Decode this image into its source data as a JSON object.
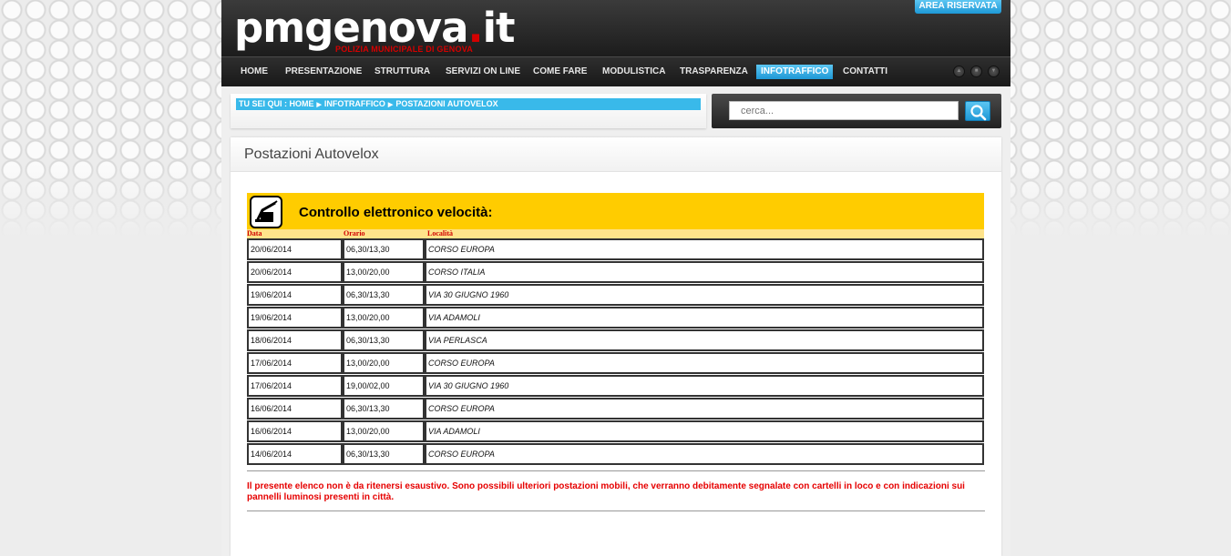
{
  "header": {
    "logo_main": "pmgenova",
    "logo_dot": ".",
    "logo_tld": "it",
    "logo_sub": "POLIZIA MUNICIPALE DI GENOVA",
    "area_riservata": "AREA RISERVATA"
  },
  "nav": {
    "items": [
      {
        "label": "HOME"
      },
      {
        "label": "PRESENTAZIONE"
      },
      {
        "label": "STRUTTURA"
      },
      {
        "label": "SERVIZI ON LINE"
      },
      {
        "label": "COME FARE"
      },
      {
        "label": "MODULISTICA"
      },
      {
        "label": "TRASPARENZA"
      },
      {
        "label": "INFOTRAFFICO",
        "active": true
      },
      {
        "label": "CONTATTI"
      }
    ]
  },
  "breadcrumb": {
    "prefix": "TU SEI QUI :",
    "items": [
      "HOME",
      "INFOTRAFFICO",
      "POSTAZIONI AUTOVELOX"
    ]
  },
  "search": {
    "placeholder": "cerca..."
  },
  "content": {
    "title": "Postazioni Autovelox",
    "banner_title": "Controllo elettronico velocità:",
    "columns": [
      "Data",
      "Orario",
      "Località"
    ],
    "rows": [
      [
        "20/06/2014",
        "06,30/13,30",
        "CORSO EUROPA"
      ],
      [
        "20/06/2014",
        "13,00/20,00",
        "CORSO ITALIA"
      ],
      [
        "19/06/2014",
        "06,30/13,30",
        "VIA 30 GIUGNO 1960"
      ],
      [
        "19/06/2014",
        "13,00/20,00",
        "VIA ADAMOLI"
      ],
      [
        "18/06/2014",
        "06,30/13,30",
        "VIA PERLASCA"
      ],
      [
        "17/06/2014",
        "13,00/20,00",
        "CORSO EUROPA"
      ],
      [
        "17/06/2014",
        "19,00/02,00",
        "VIA 30 GIUGNO 1960"
      ],
      [
        "16/06/2014",
        "06,30/13,30",
        "CORSO EUROPA"
      ],
      [
        "16/06/2014",
        "13,00/20,00",
        "VIA ADAMOLI"
      ],
      [
        "14/06/2014",
        "06,30/13,30",
        "CORSO EUROPA"
      ]
    ],
    "notice": "Il presente elenco non è da ritenersi esaustivo. Sono possibili ulteriori postazioni mobili, che verranno debitamente segnalate con cartelli in loco e con indicazioni sui pannelli luminosi presenti in città."
  },
  "colors": {
    "accent": "#39b9ea",
    "banner": "#ffcc00",
    "notice": "#e60000",
    "header": "#222222"
  }
}
